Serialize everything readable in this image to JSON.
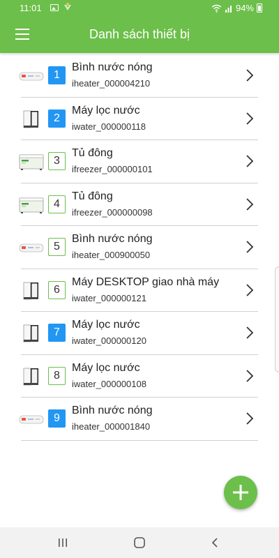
{
  "status_bar": {
    "time": "11:01",
    "battery": "94%"
  },
  "app_bar": {
    "title": "Danh sách thiết bị",
    "menu_icon": "hamburger-menu-icon"
  },
  "colors": {
    "primary": "#6cbf4a",
    "badge_blue": "#2196f3",
    "divider": "#d0d0d0"
  },
  "devices": [
    {
      "index": "1",
      "name": "Bình nước nóng",
      "code": "iheater_000004210",
      "type": "heater",
      "badge": "filled"
    },
    {
      "index": "2",
      "name": "Máy lọc nước",
      "code": "iwater_000000118",
      "type": "water",
      "badge": "filled"
    },
    {
      "index": "3",
      "name": "Tủ đông",
      "code": "ifreezer_000000101",
      "type": "freezer",
      "badge": "outline"
    },
    {
      "index": "4",
      "name": "Tủ đông",
      "code": "ifreezer_000000098",
      "type": "freezer",
      "badge": "outline"
    },
    {
      "index": "5",
      "name": "Bình nước nóng",
      "code": "iheater_000900050",
      "type": "heater",
      "badge": "outline"
    },
    {
      "index": "6",
      "name": "Máy DESKTOP giao nhà máy",
      "code": "iwater_000000121",
      "type": "water",
      "badge": "outline"
    },
    {
      "index": "7",
      "name": "Máy lọc nước",
      "code": "iwater_000000120",
      "type": "water",
      "badge": "filled"
    },
    {
      "index": "8",
      "name": "Máy lọc nước",
      "code": "iwater_000000108",
      "type": "water",
      "badge": "outline"
    },
    {
      "index": "9",
      "name": "Bình nước nóng",
      "code": "iheater_000001840",
      "type": "heater",
      "badge": "filled"
    }
  ],
  "fab": {
    "icon": "plus-icon"
  },
  "nav_bar": {
    "recents_icon": "recents-icon",
    "home_icon": "home-icon",
    "back_icon": "back-icon"
  }
}
